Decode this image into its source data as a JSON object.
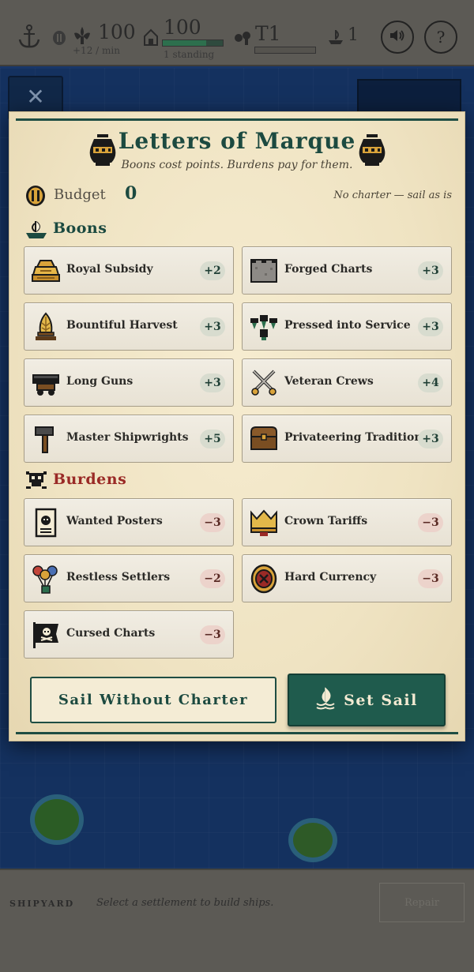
{
  "hud": {
    "gold": "100",
    "gold_rate": "+12 / min",
    "population": "100",
    "standing": "1 standing",
    "population_bar": 0.72,
    "tier": "T1",
    "tier_bar": 0.0,
    "ships": "1",
    "sound_icon": "speaker-icon",
    "help_label": "?"
  },
  "sea": {
    "close_label": "✕"
  },
  "modal": {
    "title": "Letters of Marque",
    "subtitle": "Boons cost points. Burdens pay for them.",
    "budget_label": "Budget",
    "budget_value": "0",
    "budget_note": "No charter — sail as is",
    "boons_label": "Boons",
    "burdens_label": "Burdens",
    "boons": [
      {
        "label": "Royal Subsidy",
        "cost": "+2",
        "icon": "gold-pile-icon"
      },
      {
        "label": "Forged Charts",
        "cost": "+3",
        "icon": "stone-tablet-icon"
      },
      {
        "label": "Bountiful Harvest",
        "cost": "+3",
        "icon": "wheat-sheaf-icon"
      },
      {
        "label": "Pressed into Service",
        "cost": "+3",
        "icon": "crowd-icon"
      },
      {
        "label": "Long Guns",
        "cost": "+3",
        "icon": "cannon-icon"
      },
      {
        "label": "Veteran Crews",
        "cost": "+4",
        "icon": "crossed-swords-icon"
      },
      {
        "label": "Master Shipwrights",
        "cost": "+5",
        "icon": "hammer-icon"
      },
      {
        "label": "Privateering Tradition",
        "cost": "+3",
        "icon": "treasure-chest-icon"
      }
    ],
    "burdens": [
      {
        "label": "Wanted Posters",
        "cost": "−3",
        "icon": "wanted-poster-icon"
      },
      {
        "label": "Crown Tariffs",
        "cost": "−3",
        "icon": "crown-icon"
      },
      {
        "label": "Restless Settlers",
        "cost": "−2",
        "icon": "balloons-icon"
      },
      {
        "label": "Hard Currency",
        "cost": "−3",
        "icon": "seal-coin-icon"
      },
      {
        "label": "Cursed Charts",
        "cost": "−3",
        "icon": "black-flag-icon"
      }
    ],
    "skip_label": "Sail Without Charter",
    "sail_label": "Set Sail"
  },
  "shipyard": {
    "label": "SHIPYARD",
    "hint": "Select a settlement to build ships.",
    "repair_label": "Repair"
  },
  "colors": {
    "accent_green": "#1f5b4d",
    "burden_red": "#9a2a26",
    "parchment": "#f2e7c9"
  }
}
